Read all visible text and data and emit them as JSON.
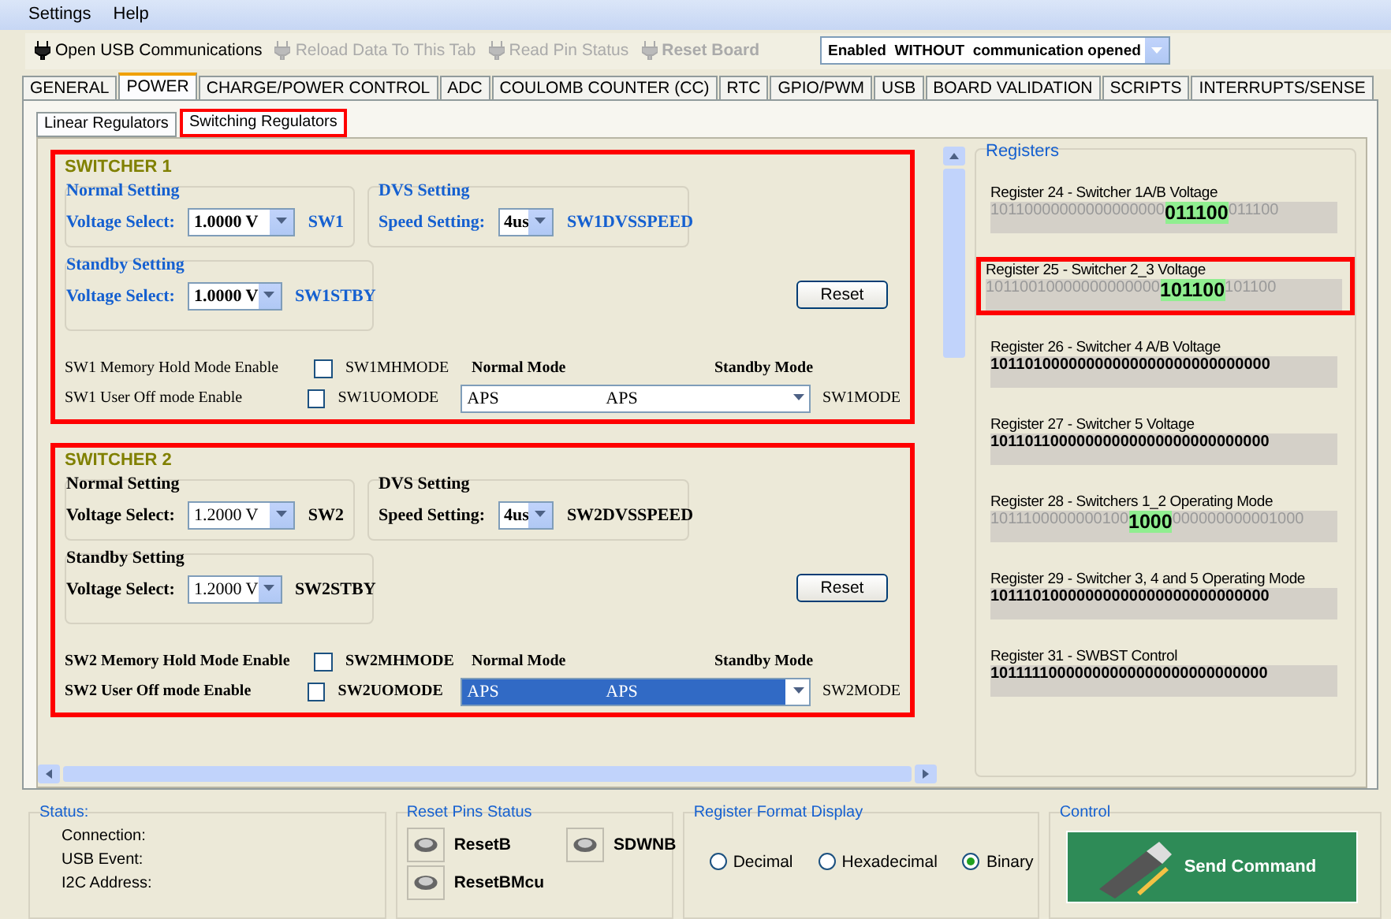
{
  "menu": [
    "Settings",
    "Help"
  ],
  "toolbar": {
    "buttons": [
      {
        "label": "Open USB Communications",
        "disabled": false
      },
      {
        "label": "Reload Data To This Tab",
        "disabled": true
      },
      {
        "label": "Read Pin Status",
        "disabled": true
      },
      {
        "label": "Reset Board",
        "disabled": true
      }
    ],
    "mode": "Enabled  WITHOUT  communication opened"
  },
  "tabs": [
    {
      "label": "GENERAL",
      "selected": false
    },
    {
      "label": "POWER",
      "selected": true
    },
    {
      "label": "CHARGE/POWER CONTROL",
      "selected": false
    },
    {
      "label": "ADC",
      "selected": false
    },
    {
      "label": "COULOMB COUNTER (CC)",
      "selected": false
    },
    {
      "label": "RTC",
      "selected": false
    },
    {
      "label": "GPIO/PWM",
      "selected": false
    },
    {
      "label": "USB",
      "selected": false
    },
    {
      "label": "BOARD VALIDATION",
      "selected": false
    },
    {
      "label": "SCRIPTS",
      "selected": false
    },
    {
      "label": "INTERRUPTS/SENSE",
      "selected": false
    }
  ],
  "subtabs": [
    {
      "label": "Linear Regulators",
      "selected": false,
      "annotated": false
    },
    {
      "label": "Switching Regulators",
      "selected": true,
      "annotated": true
    }
  ],
  "switchers": [
    {
      "title": "SWITCHER 1",
      "annotated": true,
      "changed": true,
      "normal_title": "Normal Setting",
      "voltage_label": "Voltage Select:",
      "voltage": "1.0000 V",
      "voltage_reg": "SW1",
      "dvs_title": "DVS Setting",
      "speed_label": "Speed Setting:",
      "speed": "4us",
      "speed_reg": "SW1DVSSPEED",
      "standby_title": "Standby Setting",
      "standby_label": "Voltage Select:",
      "standby_voltage": "1.0000 V",
      "standby_reg": "SW1STBY",
      "reset": "Reset",
      "mh_label": "SW1 Memory Hold Mode Enable",
      "mh_checked": false,
      "mh_reg": "SW1MHMODE",
      "uo_label": "SW1 User Off mode Enable",
      "uo_checked": false,
      "uo_reg": "SW1UOMODE",
      "normal_mode_head": "Normal Mode",
      "standby_mode_head": "Standby Mode",
      "mode_normal": "APS",
      "mode_standby": "APS",
      "mode_focused": false,
      "mode_reg": "SW1MODE"
    },
    {
      "title": "SWITCHER 2",
      "annotated": true,
      "changed": false,
      "normal_title": "Normal Setting",
      "voltage_label": "Voltage Select:",
      "voltage": "1.2000 V",
      "voltage_reg": "SW2",
      "dvs_title": "DVS Setting",
      "speed_label": "Speed Setting:",
      "speed": "4us",
      "speed_reg": "SW2DVSSPEED",
      "standby_title": "Standby Setting",
      "standby_label": "Voltage Select:",
      "standby_voltage": "1.2000 V",
      "standby_reg": "SW2STBY",
      "reset": "Reset",
      "mh_label": "SW2 Memory Hold Mode Enable",
      "mh_checked": false,
      "mh_reg": "SW2MHMODE",
      "uo_label": "SW2 User Off mode Enable",
      "uo_checked": false,
      "uo_reg": "SW2UOMODE",
      "normal_mode_head": "Normal Mode",
      "standby_mode_head": "Standby Mode",
      "mode_normal": "APS",
      "mode_standby": "APS",
      "mode_focused": true,
      "mode_reg": "SW2MODE"
    }
  ],
  "registers": {
    "title": "Registers",
    "items": [
      {
        "label": "Register 24 - Switcher 1A/B Voltage",
        "kind": "highlighted",
        "annotated": false,
        "before": "10110000000000000000",
        "highlight": "011100",
        "after": "011100"
      },
      {
        "label": "Register 25 - Switcher 2_3 Voltage",
        "kind": "highlighted",
        "annotated": true,
        "before": "10110010000000000000",
        "highlight": "101100",
        "after": "101100"
      },
      {
        "label": "Register 26 - Switcher 4 A/B Voltage",
        "kind": "plain",
        "annotated": false,
        "value": "10110100000000000000000000000000"
      },
      {
        "label": "Register 27 - Switcher 5 Voltage",
        "kind": "plain",
        "annotated": false,
        "value": "10110110000000000000000000000000"
      },
      {
        "label": "Register 28 - Switchers 1_2 Operating Mode",
        "kind": "highlighted",
        "annotated": false,
        "before": "1011100000000100",
        "highlight": "1000",
        "after": "000000000001000"
      },
      {
        "label": "Register 29 - Switcher 3, 4 and 5 Operating Mode",
        "kind": "plain",
        "annotated": false,
        "value": "10111010000000000000000000000000"
      },
      {
        "label": "Register 31 - SWBST Control",
        "kind": "plain",
        "annotated": false,
        "value": "10111110000000000000000000000000"
      }
    ]
  },
  "status": {
    "title": "Status:",
    "lines": [
      "Connection:",
      "USB Event:",
      "I2C Address:"
    ]
  },
  "reset_pins": {
    "title": "Reset Pins Status",
    "pins": [
      "ResetB",
      "SDWNB",
      "ResetBMcu"
    ]
  },
  "register_format": {
    "title": "Register Format Display",
    "options": [
      {
        "label": "Decimal",
        "selected": false
      },
      {
        "label": "Hexadecimal",
        "selected": false
      },
      {
        "label": "Binary",
        "selected": true
      }
    ]
  },
  "control": {
    "title": "Control",
    "button": "Send Command"
  }
}
